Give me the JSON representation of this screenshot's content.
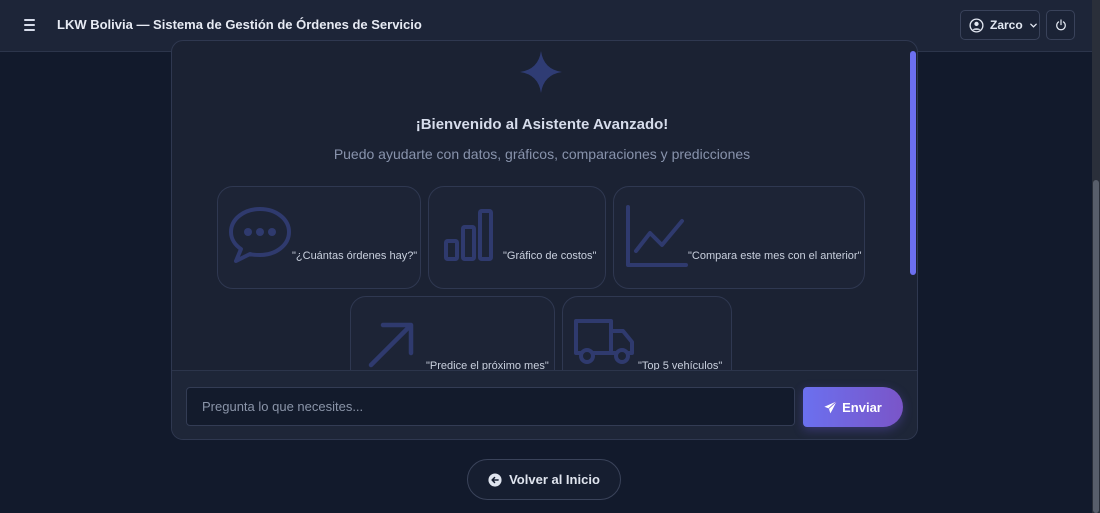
{
  "header": {
    "title": "LKW Bolivia — Sistema de Gestión de Órdenes de Servicio",
    "user_name": "Zarco",
    "icons": {
      "menu": "hamburger-menu-icon",
      "user": "user-circle-icon",
      "dropdown": "chevron-down-icon",
      "power": "power-icon"
    }
  },
  "assistant": {
    "welcome_title": "¡Bienvenido al Asistente Avanzado!",
    "welcome_subtitle": "Puedo ayudarte con datos, gráficos, comparaciones y predicciones",
    "suggestions": [
      {
        "icon": "chat-bubble-icon",
        "label": "\"¿Cuántas órdenes hay?\""
      },
      {
        "icon": "bar-chart-icon",
        "label": "\"Gráfico de costos\""
      },
      {
        "icon": "line-chart-icon",
        "label": "\"Compara este mes con el anterior\""
      },
      {
        "icon": "arrow-up-right-icon",
        "label": "\"Predice el próximo mes\""
      },
      {
        "icon": "truck-icon",
        "label": "\"Top 5 vehículos\""
      }
    ],
    "input_placeholder": "Pregunta lo que necesites...",
    "send_label": "Enviar"
  },
  "footer": {
    "back_label": "Volver al Inicio"
  },
  "colors": {
    "background": "#121a2c",
    "accent_start": "#6b70ef",
    "accent_end": "#7a55c8",
    "icon_muted": "#2f3a6e"
  }
}
